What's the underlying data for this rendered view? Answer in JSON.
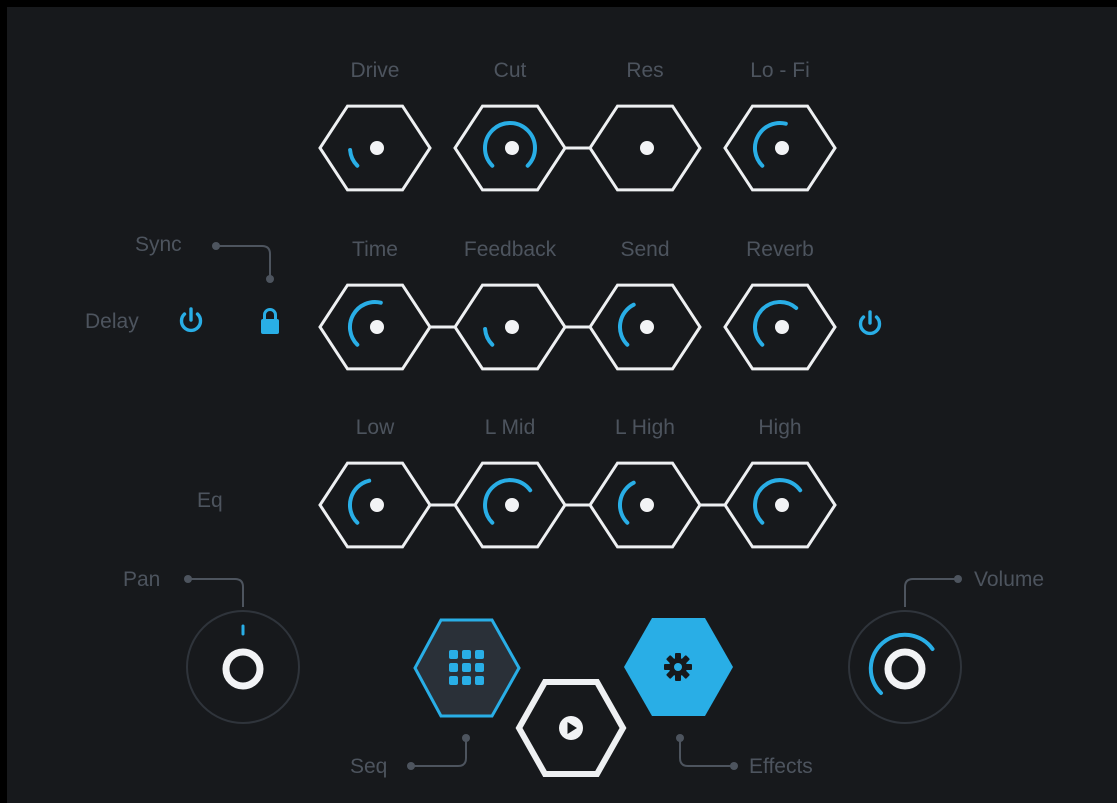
{
  "colors": {
    "accent": "#29aee6",
    "label": "#4d545e",
    "outline": "#eef0f2",
    "background": "#17191c"
  },
  "rows": [
    {
      "row_label": "",
      "knobs": [
        {
          "label": "Drive",
          "level": 0.15,
          "linked_next": false
        },
        {
          "label": "Cut",
          "level": 1.0,
          "linked_next": true
        },
        {
          "label": "Res",
          "level": 0.0,
          "linked_next": false
        },
        {
          "label": "Lo - Fi",
          "level": 0.55,
          "linked_next": false
        }
      ]
    },
    {
      "row_label": "Delay",
      "knobs": [
        {
          "label": "Time",
          "level": 0.55,
          "linked_next": true
        },
        {
          "label": "Feedback",
          "level": 0.15,
          "linked_next": true
        },
        {
          "label": "Send",
          "level": 0.4,
          "linked_next": false
        },
        {
          "label": "Reverb",
          "level": 0.65,
          "linked_next": false
        }
      ]
    },
    {
      "row_label": "Eq",
      "knobs": [
        {
          "label": "Low",
          "level": 0.45,
          "linked_next": true
        },
        {
          "label": "L Mid",
          "level": 0.7,
          "linked_next": true
        },
        {
          "label": "L High",
          "level": 0.4,
          "linked_next": true
        },
        {
          "label": "High",
          "level": 0.7,
          "linked_next": false
        }
      ]
    }
  ],
  "sync_label": "Sync",
  "delay_power_icon": "power-icon",
  "reverb_power_icon": "power-icon",
  "lock_icon": "lock-icon",
  "pan": {
    "label": "Pan",
    "value": 0.5
  },
  "volume": {
    "label": "Volume",
    "level": 0.7
  },
  "buttons": {
    "seq": {
      "label": "Seq",
      "icon": "grid-icon"
    },
    "play": {
      "icon": "play-icon"
    },
    "effects": {
      "label": "Effects",
      "icon": "gear-icon"
    }
  }
}
